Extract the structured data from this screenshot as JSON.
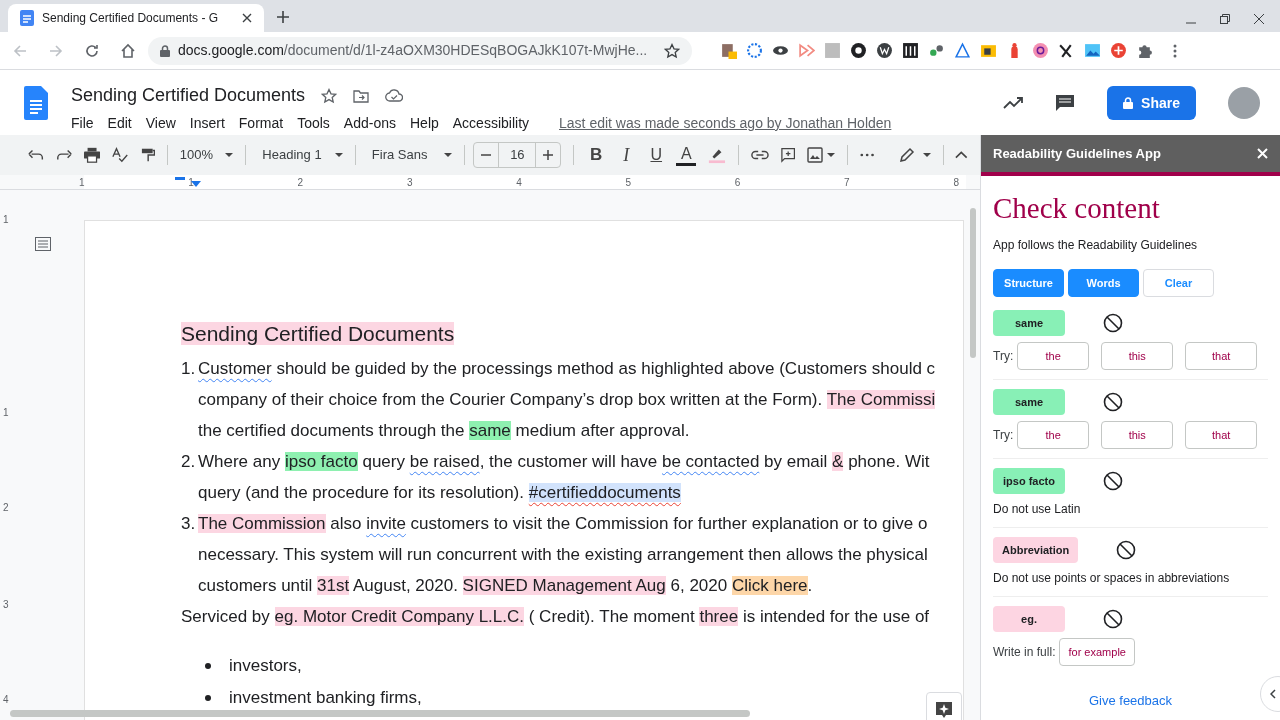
{
  "browser": {
    "tab_title": "Sending Certified Documents - G",
    "url_domain": "docs.google.com",
    "url_path": "/document/d/1l-z4aOXM30HDESqBOGAJkK107t-MwjHe..."
  },
  "doc_header": {
    "title": "Sending Certified Documents",
    "menu": [
      "File",
      "Edit",
      "View",
      "Insert",
      "Format",
      "Tools",
      "Add-ons",
      "Help",
      "Accessibility"
    ],
    "last_edit": "Last edit was made seconds ago by Jonathan Holden",
    "share": "Share"
  },
  "toolbar": {
    "zoom": "100%",
    "style": "Heading 1",
    "font": "Fira Sans",
    "size": "16",
    "format": [
      {
        "label": "B",
        "kind": "bold"
      },
      {
        "label": "I",
        "kind": "italic"
      },
      {
        "label": "U",
        "kind": "underline"
      },
      {
        "label": "A",
        "kind": "text-color"
      }
    ]
  },
  "ruler": [
    "1",
    "1",
    "2",
    "3",
    "4",
    "5",
    "6",
    "7",
    "8"
  ],
  "vertical_ruler": [
    "1",
    "1",
    "2",
    "3",
    "4"
  ],
  "document": {
    "lines": [
      {
        "kind": "heading",
        "segments": [
          {
            "text": "Sending Certified Documents",
            "kind": "flagged"
          }
        ]
      },
      {
        "kind": "numbered",
        "number": "1.",
        "segments": [
          {
            "text": "Customer",
            "kind": "grammar"
          },
          {
            "text": " should be guided by the processings method as highlighted above (Customers should c",
            "kind": "text"
          }
        ]
      },
      {
        "kind": "continuation",
        "segments": [
          {
            "text": "company of their choice from the Courier Company’s drop box written at the Form). ",
            "kind": "text"
          },
          {
            "text": "The Commissi",
            "kind": "flagged"
          }
        ]
      },
      {
        "kind": "continuation",
        "segments": [
          {
            "text": "the certified documents through the ",
            "kind": "text"
          },
          {
            "text": "same",
            "kind": "plain-language"
          },
          {
            "text": " medium after approval.",
            "kind": "text"
          }
        ]
      },
      {
        "kind": "numbered",
        "number": "2.",
        "segments": [
          {
            "text": "Where any ",
            "kind": "text"
          },
          {
            "text": "ipso facto",
            "kind": "plain-language"
          },
          {
            "text": " query ",
            "kind": "text"
          },
          {
            "text": "be raised",
            "kind": "grammar"
          },
          {
            "text": ", the customer will have ",
            "kind": "text"
          },
          {
            "text": "be contacted",
            "kind": "grammar"
          },
          {
            "text": " by email ",
            "kind": "text"
          },
          {
            "text": "&",
            "kind": "flagged"
          },
          {
            "text": " phone. Wit",
            "kind": "text"
          }
        ]
      },
      {
        "kind": "continuation",
        "segments": [
          {
            "text": "query (and the procedure for its resolution). ",
            "kind": "text"
          },
          {
            "text": "#certifieddocuments",
            "kind": "hashtag"
          }
        ]
      },
      {
        "kind": "numbered",
        "number": "3.",
        "segments": [
          {
            "text": "The Commission",
            "kind": "flagged"
          },
          {
            "text": " also ",
            "kind": "text"
          },
          {
            "text": "invite",
            "kind": "grammar"
          },
          {
            "text": " customers to visit the Commission for further explanation or to give o",
            "kind": "text"
          }
        ]
      },
      {
        "kind": "continuation",
        "segments": [
          {
            "text": "necessary. This system will run concurrent with the existing arrangement then allows the physical",
            "kind": "text"
          }
        ]
      },
      {
        "kind": "continuation",
        "segments": [
          {
            "text": "customers until ",
            "kind": "text"
          },
          {
            "text": "31st",
            "kind": "flagged"
          },
          {
            "text": " August, 2020. ",
            "kind": "text"
          },
          {
            "text": "SIGNED Management Aug",
            "kind": "flagged"
          },
          {
            "text": " 6, 2020 ",
            "kind": "text"
          },
          {
            "text": "Click here",
            "kind": "link"
          },
          {
            "text": ".",
            "kind": "text"
          }
        ]
      },
      {
        "kind": "paragraph",
        "segments": [
          {
            "text": "Serviced by ",
            "kind": "text"
          },
          {
            "text": "eg. Motor Credit Company L.L.C.",
            "kind": "flagged"
          },
          {
            "text": " ( Credit). The moment ",
            "kind": "text"
          },
          {
            "text": "three",
            "kind": "flagged"
          },
          {
            "text": " is intended for the use of",
            "kind": "text"
          }
        ]
      },
      {
        "kind": "bullet",
        "segments": [
          {
            "text": "investors,",
            "kind": "text"
          }
        ]
      },
      {
        "kind": "bullet",
        "segments": [
          {
            "text": "investment banking firms,",
            "kind": "text"
          }
        ]
      }
    ]
  },
  "sidebar": {
    "title": "Readability Guidelines App",
    "heading": "Check content",
    "subtitle": "App follows the Readability Guidelines",
    "buttons": [
      {
        "label": "Structure",
        "kind": "primary"
      },
      {
        "label": "Words",
        "kind": "primary"
      },
      {
        "label": "Clear",
        "kind": "secondary"
      }
    ],
    "cards": [
      {
        "term": "same",
        "color": "#88f0b6",
        "try_label": "Try:",
        "suggestions": [
          "the",
          "this",
          "that"
        ]
      },
      {
        "term": "same",
        "color": "#88f0b6",
        "try_label": "Try:",
        "suggestions": [
          "the",
          "this",
          "that"
        ]
      },
      {
        "term": "ipso facto",
        "color": "#88f0b6",
        "advice": "Do not use Latin"
      },
      {
        "term": "Abbreviation",
        "color": "#fdd5e2",
        "advice": "Do not use points or spaces in abbreviations"
      },
      {
        "term": "eg.",
        "color": "#fdd5e2",
        "try_label": "Write in full:",
        "suggestions": [
          "for example"
        ]
      }
    ],
    "feedback": "Give feedback"
  }
}
